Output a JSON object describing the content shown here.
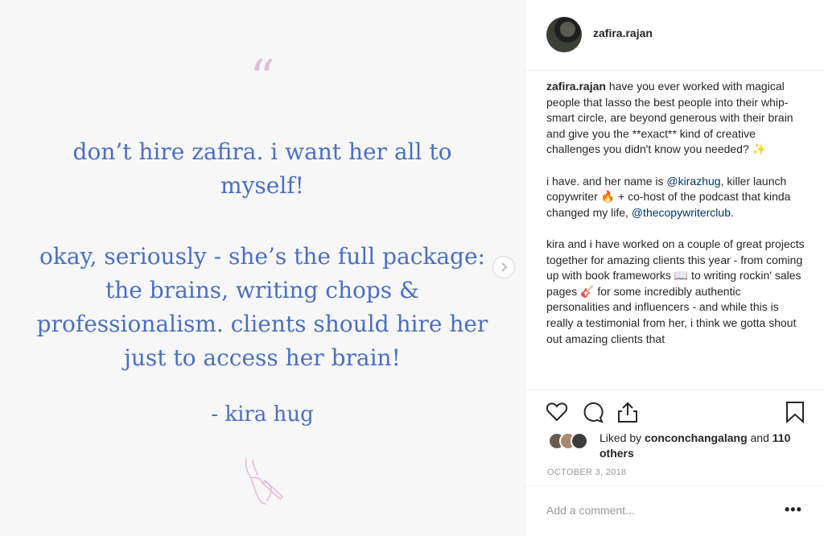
{
  "post": {
    "quote_mark": "“",
    "quote_part1": "don’t hire zafira. i want her all to myself!",
    "quote_part2": "okay, seriously - she’s the full package: the brains, writing chops & professionalism. clients should hire her just to access her brain!",
    "author": "- kira hug",
    "colors": {
      "quote_text": "#4a6fc3",
      "quote_mark": "#e3bcd9",
      "background": "#f7f7f7"
    }
  },
  "header": {
    "username": "zafira.rajan"
  },
  "caption": {
    "username": "zafira.rajan",
    "p1_text": " have you ever worked with magical people that lasso the best people into their whip-smart circle, are beyond generous with their brain and give you the **exact** kind of creative challenges you didn't know you needed? ",
    "p1_emoji": "✨",
    "p2_a": "i have. and her name is ",
    "p2_mention1": "@kirazhug",
    "p2_b": ", killer launch copywriter ",
    "p2_emoji": "🔥",
    "p2_c": " + co-host of the podcast that kinda changed my life, ",
    "p2_mention2": "@thecopywriterclub",
    "p2_d": ".",
    "p3_a": "kira and i have worked on a couple of great projects together for amazing clients this year - from coming up with book frameworks ",
    "p3_emoji1": "📖",
    "p3_b": " to writing rockin' sales pages ",
    "p3_emoji2": "🎸",
    "p3_c": " for some incredibly authentic personalities and influencers - and while this is really a testimonial from her, i think we gotta shout out amazing clients that"
  },
  "actions": {
    "icons": [
      "heart-icon",
      "comment-icon",
      "share-icon",
      "bookmark-icon"
    ]
  },
  "likes": {
    "prefix": "Liked by ",
    "user": "conconchangalang",
    "and": " and ",
    "others": "110 others"
  },
  "date": "OCTOBER 3, 2018",
  "comment": {
    "placeholder": "Add a comment...",
    "more": "•••"
  }
}
